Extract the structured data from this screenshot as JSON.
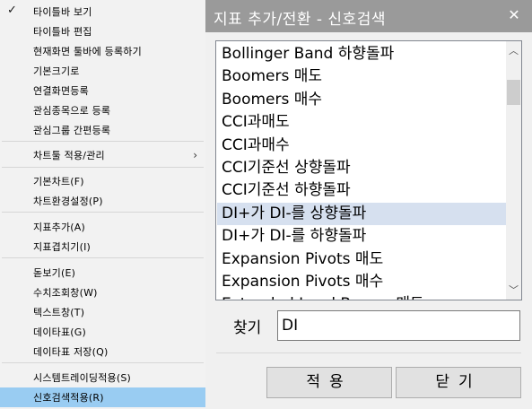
{
  "menu": {
    "items": [
      {
        "label": "타이틀바 보기",
        "checked": true
      },
      {
        "label": "타이틀바 편집"
      },
      {
        "label": "현재화면 툴바에 등록하기"
      },
      {
        "label": "기본크기로"
      },
      {
        "label": "연결화면등록"
      },
      {
        "label": "관심종목으로 등록"
      },
      {
        "label": "관심그룹 간편등록"
      },
      {
        "label": "차트툴 적용/관리",
        "submenu": true
      },
      {
        "label": "기본차트(F)"
      },
      {
        "label": "차트환경설정(P)"
      },
      {
        "label": "지표추가(A)"
      },
      {
        "label": "지표겹치기(I)"
      },
      {
        "label": "돋보기(E)"
      },
      {
        "label": "수치조회창(W)"
      },
      {
        "label": "텍스트창(T)"
      },
      {
        "label": "데이타표(G)"
      },
      {
        "label": "데이타표 저장(Q)"
      },
      {
        "label": "시스템트레이딩적용(S)"
      },
      {
        "label": "신호검색적용(R)",
        "selected": true
      }
    ],
    "check_glyph": "✓",
    "submenu_glyph": "›",
    "selected_color": "#99ccf2"
  },
  "dialog": {
    "title": "지표 추가/전환 - 신호검색",
    "close_glyph": "✕",
    "list_items": [
      "Bollinger Band 하향돌파",
      "Boomers 매도",
      "Boomers 매수",
      "CCI과매도",
      "CCI과매수",
      "CCI기준선 상향돌파",
      "CCI기준선 하향돌파",
      "DI+가 DI-를 상향돌파",
      "DI+가 DI-를 하향돌파",
      "Expansion Pivots 매도",
      "Expansion Pivots 매수",
      "Extended Lead Bearer 매도"
    ],
    "highlighted_index": 7,
    "scroll": {
      "up_glyph": "︿",
      "down_glyph": "﹀"
    },
    "find_label": "찾기",
    "find_value": "DI",
    "apply_label": "적용",
    "close_label": "닫기",
    "highlight_color": "#d6e0ef"
  }
}
